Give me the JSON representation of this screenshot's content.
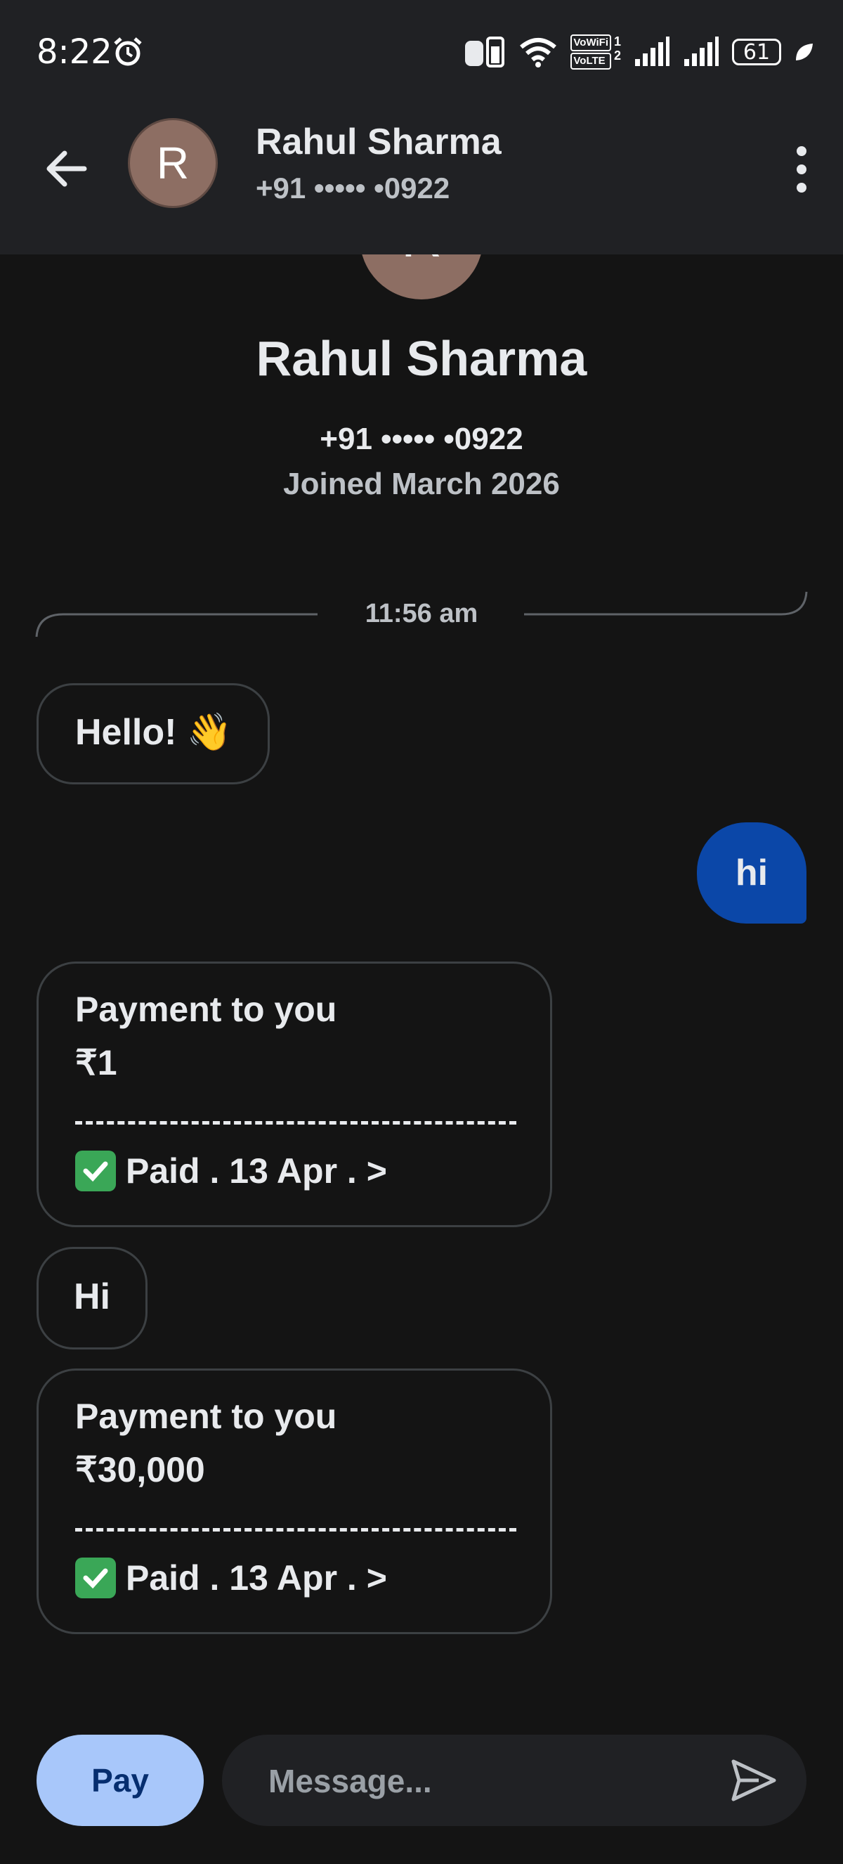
{
  "status_bar": {
    "time": "8:22",
    "vowifi_label": "VoWiFi",
    "volte_label": "VoLTE",
    "sim1": "1",
    "sim2": "2",
    "battery": "61"
  },
  "header": {
    "avatar_initial": "R",
    "name": "Rahul Sharma",
    "phone": "+91 ••••• •0922"
  },
  "profile": {
    "avatar_initial": "R",
    "name": "Rahul Sharma",
    "phone": "+91 ••••• •0922",
    "joined": "Joined March 2026"
  },
  "conversation": {
    "timestamp": "11:56 am",
    "messages": [
      {
        "direction": "incoming",
        "type": "text",
        "text": "Hello! 👋"
      },
      {
        "direction": "outgoing",
        "type": "text",
        "text": "hi"
      },
      {
        "direction": "incoming",
        "type": "payment",
        "title": "Payment to you",
        "amount": "₹1",
        "status": "Paid . 13 Apr . >"
      },
      {
        "direction": "incoming",
        "type": "text",
        "text": "Hi"
      },
      {
        "direction": "incoming",
        "type": "payment",
        "title": "Payment to you",
        "amount": "₹30,000",
        "status": "Paid . 13 Apr . >"
      }
    ]
  },
  "composer": {
    "pay_label": "Pay",
    "placeholder": "Message..."
  },
  "colors": {
    "background": "#141414",
    "app_bar": "#202124",
    "outgoing_bubble": "#0b47a8",
    "pay_button": "#a8c7fa",
    "avatar": "#8d6e63"
  }
}
